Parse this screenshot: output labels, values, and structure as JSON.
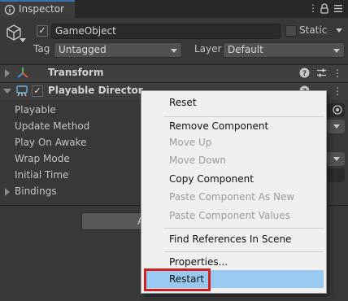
{
  "tab": {
    "label": "Inspector",
    "icon": "info-icon"
  },
  "top_icons": [
    "more-vertical-icon",
    "lock-icon",
    "menu-icon"
  ],
  "header": {
    "name_value": "GameObject",
    "static_label": "Static",
    "tag_label": "Tag",
    "tag_value": "Untagged",
    "layer_label": "Layer",
    "layer_value": "Default"
  },
  "components": {
    "transform": {
      "title": "Transform"
    },
    "director": {
      "title": "Playable Director",
      "rows": [
        "Playable",
        "Update Method",
        "Play On Awake",
        "Wrap Mode",
        "Initial Time",
        "Bindings"
      ]
    }
  },
  "bottom_button_partial": "A",
  "menu": {
    "items": {
      "reset": "Reset",
      "remove": "Remove Component",
      "move_up": "Move Up",
      "move_down": "Move Down",
      "copy": "Copy Component",
      "paste_new": "Paste Component As New",
      "paste_values": "Paste Component Values",
      "find_refs": "Find References In Scene",
      "properties": "Properties...",
      "restart": "Restart"
    },
    "highlighted": "Restart"
  },
  "colors": {
    "accent": "#3a72b0",
    "highlight": "#99c9f0",
    "annotation": "#d21f1f"
  }
}
